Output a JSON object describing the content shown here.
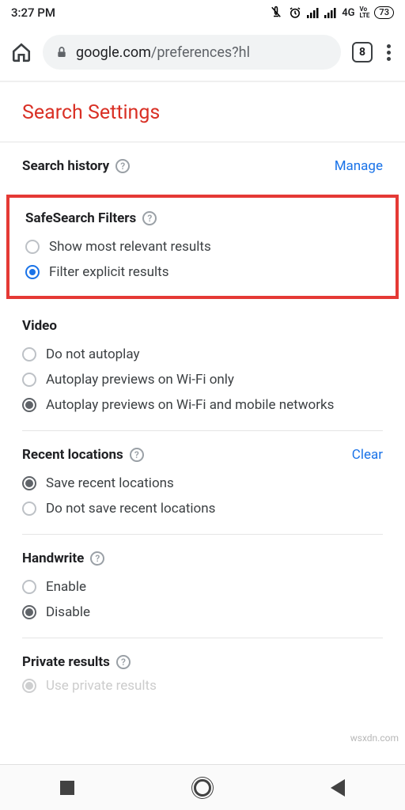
{
  "status": {
    "time": "3:27 PM",
    "net": "4G",
    "volte": "Vo\nLTE",
    "battery": "73"
  },
  "browser": {
    "url_domain": "google.com",
    "url_path": "/preferences?hl",
    "tab_count": "8"
  },
  "page": {
    "title": "Search Settings"
  },
  "sections": {
    "search_history": {
      "title": "Search history",
      "action": "Manage"
    },
    "safesearch": {
      "title": "SafeSearch Filters",
      "opt_relevant": "Show most relevant results",
      "opt_filter": "Filter explicit results"
    },
    "video": {
      "title": "Video",
      "opt_no": "Do not autoplay",
      "opt_wifi": "Autoplay previews on Wi-Fi only",
      "opt_all": "Autoplay previews on Wi-Fi and mobile networks"
    },
    "locations": {
      "title": "Recent locations",
      "action": "Clear",
      "opt_save": "Save recent locations",
      "opt_nosave": "Do not save recent locations"
    },
    "handwrite": {
      "title": "Handwrite",
      "opt_enable": "Enable",
      "opt_disable": "Disable"
    },
    "private": {
      "title": "Private results",
      "opt_use": "Use private results"
    }
  },
  "watermark": "wsxdn.com"
}
